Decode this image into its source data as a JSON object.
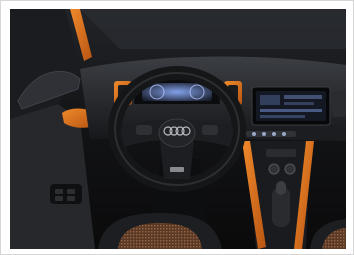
{
  "image": {
    "subject": "car-interior-dashboard",
    "accent_color": "#e0701f",
    "seat_fabric_color": "#8a5a3a",
    "screen_glow_color": "#6a86c7",
    "caption": ""
  }
}
